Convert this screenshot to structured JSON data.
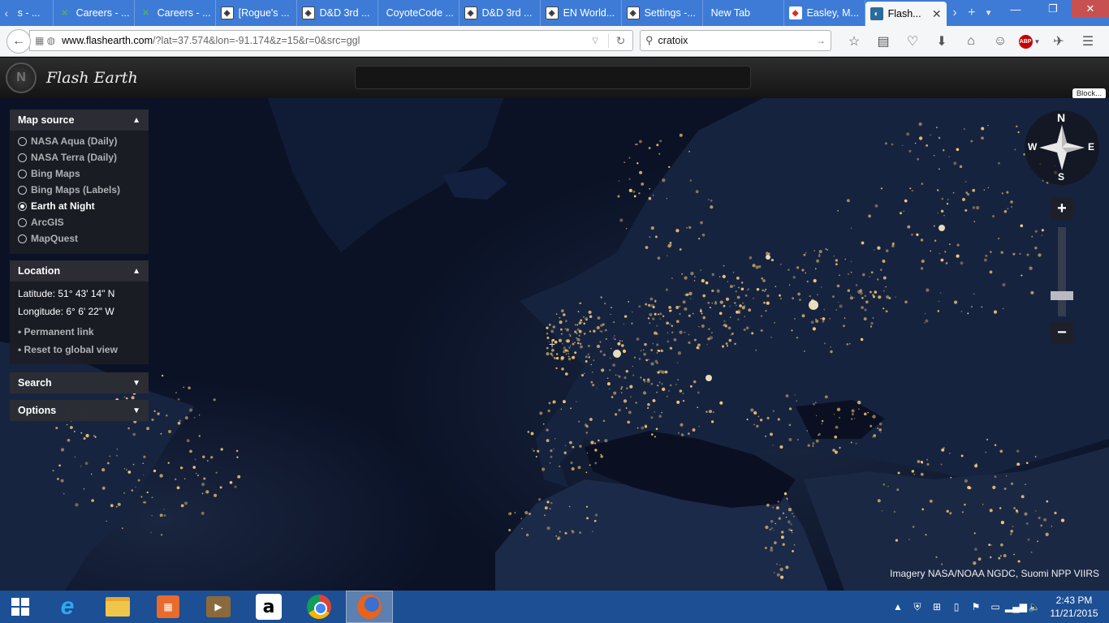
{
  "browser": {
    "tabs": [
      {
        "label": "s - ...",
        "favicon": "generic-page-icon"
      },
      {
        "label": "Careers - ...",
        "favicon": "xing-icon"
      },
      {
        "label": "Careers - ...",
        "favicon": "xing-icon"
      },
      {
        "label": "[Rogue's ...",
        "favicon": "dnd-icon"
      },
      {
        "label": "D&D 3rd ...",
        "favicon": "dnd-icon"
      },
      {
        "label": "CoyoteCode ...",
        "favicon": "none"
      },
      {
        "label": "D&D 3rd ...",
        "favicon": "dnd-icon"
      },
      {
        "label": "EN World...",
        "favicon": "dnd-icon"
      },
      {
        "label": "Settings -...",
        "favicon": "dnd-icon"
      },
      {
        "label": "New Tab",
        "favicon": "none"
      },
      {
        "label": "Easley, M...",
        "favicon": "maps-icon"
      }
    ],
    "active_tab": {
      "label": "Flash...",
      "favicon": "flash-earth-icon"
    },
    "url_host": "www.flashearth.com",
    "url_rest": "/?lat=37.574&lon=-91.174&z=15&r=0&src=ggl",
    "search_value": "cratoix"
  },
  "app": {
    "title": "Flash Earth",
    "block_label": "Block..."
  },
  "panels": {
    "map_source": {
      "title": "Map source",
      "options": [
        "NASA Aqua (Daily)",
        "NASA Terra (Daily)",
        "Bing Maps",
        "Bing Maps (Labels)",
        "Earth at Night",
        "ArcGIS",
        "MapQuest"
      ],
      "selected": "Earth at Night"
    },
    "location": {
      "title": "Location",
      "latitude": "Latitude: 51° 43' 14\" N",
      "longitude": "Longitude: 6° 6' 22\" W",
      "permanent_link": "Permanent link",
      "reset": "Reset to global view"
    },
    "search": {
      "title": "Search"
    },
    "options": {
      "title": "Options"
    }
  },
  "compass": {
    "n": "N",
    "e": "E",
    "s": "S",
    "w": "W"
  },
  "zoom": {
    "plus": "+",
    "minus": "−",
    "level": 0.2
  },
  "attribution": "Imagery NASA/NOAA NGDC, Suomi NPP VIIRS",
  "taskbar": {
    "apps": [
      "internet-explorer-icon",
      "file-explorer-icon",
      "calendar-app-icon",
      "video-app-icon",
      "amazon-icon",
      "chrome-icon",
      "firefox-icon"
    ],
    "time": "2:43 PM",
    "date": "11/21/2015"
  },
  "colors": {
    "tabstrip": "#3e7bd6",
    "taskbar": "#1d4f94",
    "city_lights": "#ffd27a",
    "ocean": "#0b1226"
  }
}
